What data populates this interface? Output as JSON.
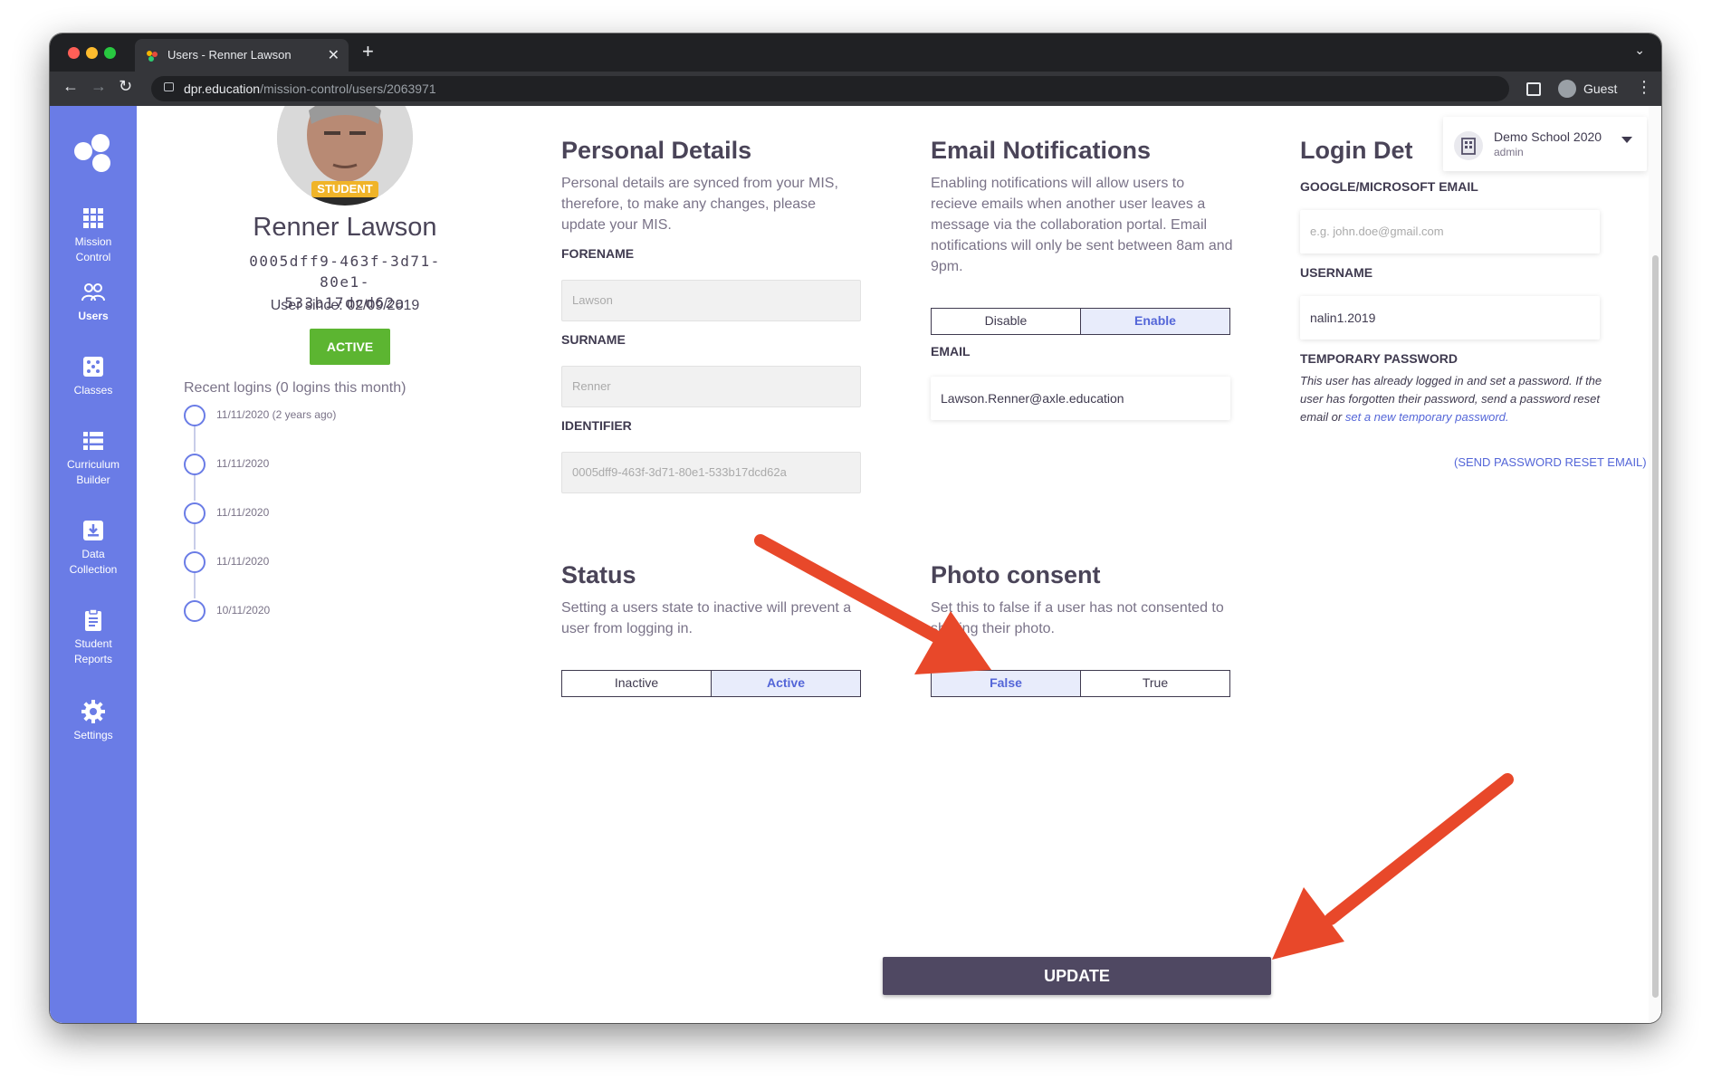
{
  "browser": {
    "tab_title": "Users - Renner Lawson",
    "new_tab_symbol": "+",
    "url_host": "dpr.education",
    "url_path": "/mission-control/users/2063971",
    "profile_label": "Guest"
  },
  "sidebar": {
    "items": [
      {
        "label": "Mission\nControl",
        "icon": "grid-icon"
      },
      {
        "label": "Users",
        "icon": "users-icon"
      },
      {
        "label": "Classes",
        "icon": "dice-icon"
      },
      {
        "label": "Curriculum\nBuilder",
        "icon": "list-icon"
      },
      {
        "label": "Data\nCollection",
        "icon": "download-box-icon"
      },
      {
        "label": "Student\nReports",
        "icon": "clipboard-icon"
      },
      {
        "label": "Settings",
        "icon": "gear-icon"
      }
    ]
  },
  "profile": {
    "role_badge": "STUDENT",
    "name": "Renner Lawson",
    "uuid_line1": "0005dff9-463f-3d71-80e1-",
    "uuid_line2": "533b17dcd62a",
    "user_since": "User since: 02/09/2019",
    "status_button": "ACTIVE",
    "recent_logins_title": "Recent logins (0 logins this month)",
    "logins": [
      "11/11/2020 (2 years ago)",
      "11/11/2020",
      "11/11/2020",
      "11/11/2020",
      "10/11/2020"
    ]
  },
  "personal": {
    "title": "Personal Details",
    "description": "Personal details are synced from your MIS, therefore, to make any changes, please update your MIS.",
    "forename_label": "FORENAME",
    "forename_value": "Lawson",
    "surname_label": "SURNAME",
    "surname_value": "Renner",
    "identifier_label": "IDENTIFIER",
    "identifier_value": "0005dff9-463f-3d71-80e1-533b17dcd62a"
  },
  "email_notifications": {
    "title": "Email Notifications",
    "description": "Enabling notifications will allow users to recieve emails when another user leaves a message via the collaboration portal. Email notifications will only be sent between 8am and 9pm.",
    "option_disable": "Disable",
    "option_enable": "Enable",
    "selected": "Enable",
    "email_label": "EMAIL",
    "email_value": "Lawson.Renner@axle.education"
  },
  "login_details": {
    "title": "Login Det",
    "google_label": "GOOGLE/MICROSOFT EMAIL",
    "google_placeholder": "e.g. john.doe@gmail.com",
    "username_label": "USERNAME",
    "username_value": "nalin1.2019",
    "temp_password_label": "TEMPORARY PASSWORD",
    "temp_password_desc": "This user has already logged in and set a password. If the user has forgotten their password, send a password reset email or",
    "temp_password_link": "set a new temporary password.",
    "reset_link": "(SEND PASSWORD RESET EMAIL)"
  },
  "school": {
    "name": "Demo School 2020",
    "role": "admin"
  },
  "status": {
    "title": "Status",
    "description": "Setting a users state to inactive will prevent a user from logging in.",
    "option_inactive": "Inactive",
    "option_active": "Active",
    "selected": "Active"
  },
  "photo_consent": {
    "title": "Photo consent",
    "description": "Set this to false if a user has not consented to sharing their photo.",
    "option_false": "False",
    "option_true": "True",
    "selected": "False"
  },
  "update_button": "UPDATE",
  "colors": {
    "sidebar": "#6a7ce6",
    "active_green": "#5cb531",
    "badge_yellow": "#f0b429",
    "update_button": "#4f4862",
    "annotation_arrow": "#e8482a"
  }
}
